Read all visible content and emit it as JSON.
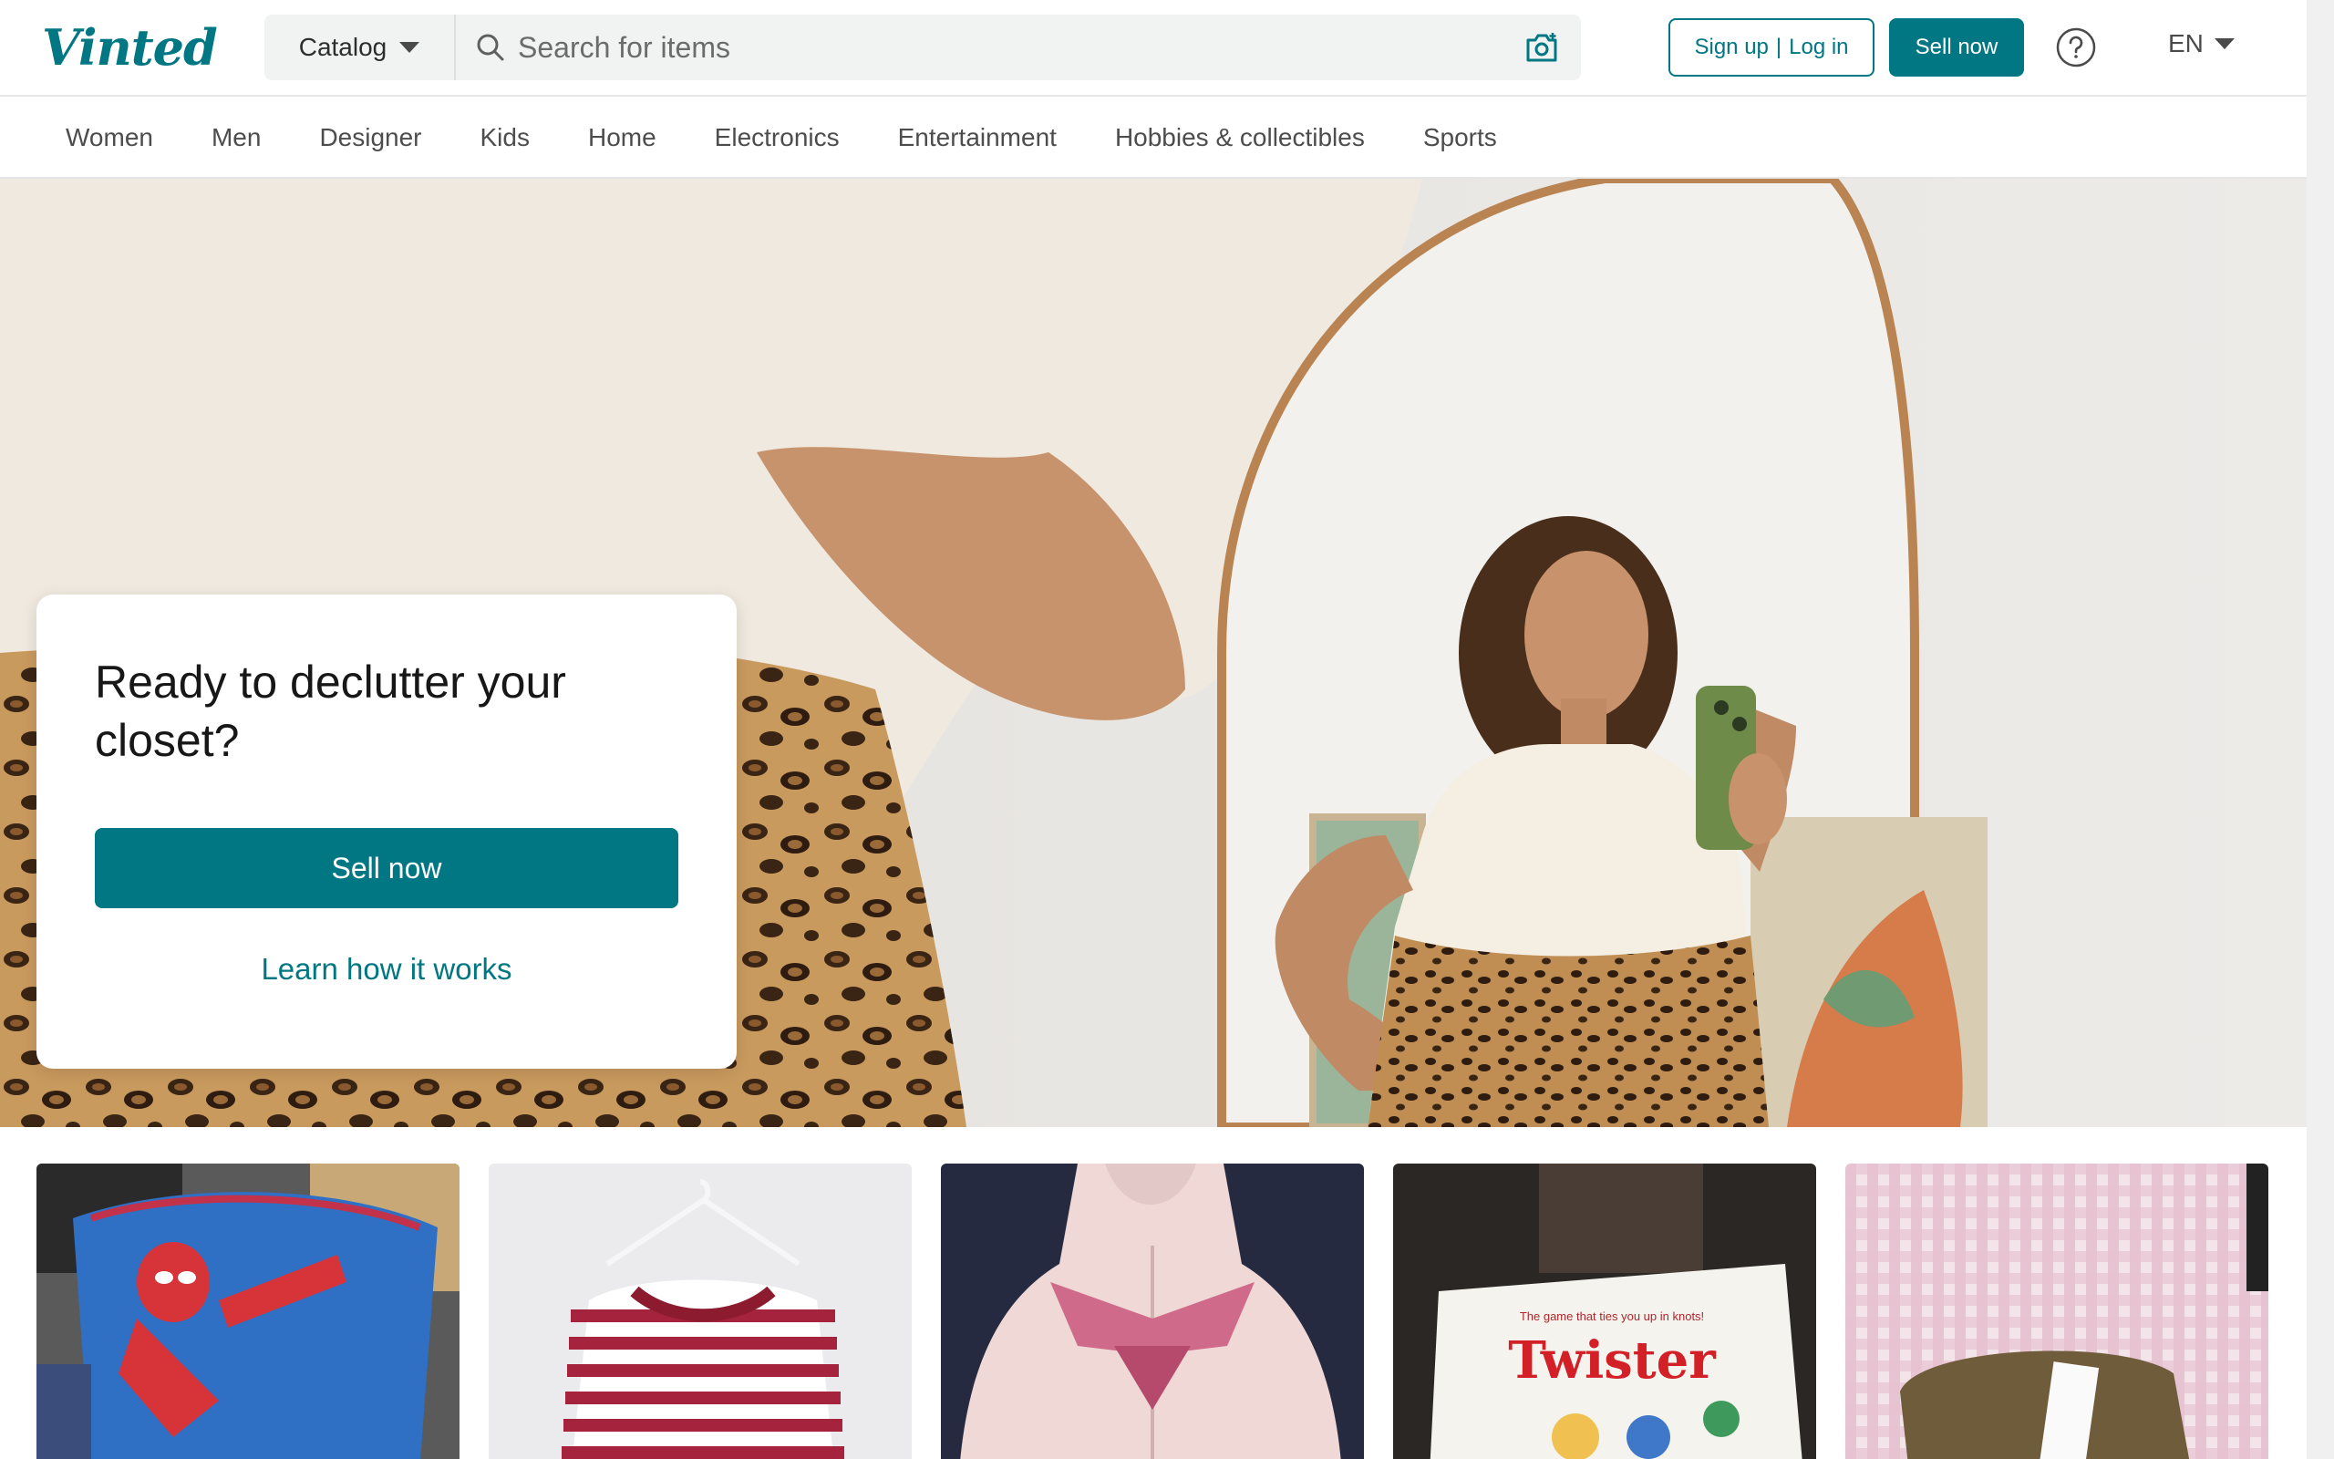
{
  "header": {
    "logo": "Vinted",
    "catalog_label": "Catalog",
    "search_placeholder": "Search for items",
    "signup_label": "Sign up",
    "login_label": "Log in",
    "sell_now_label": "Sell now",
    "language": "EN"
  },
  "categories": [
    "Women",
    "Men",
    "Designer",
    "Kids",
    "Home",
    "Electronics",
    "Entertainment",
    "Hobbies & collectibles",
    "Sports"
  ],
  "hero": {
    "title": "Ready to declutter your closet?",
    "sell_now_label": "Sell now",
    "learn_label": "Learn how it works"
  },
  "items": {
    "twister_text": "Twister",
    "twister_tagline": "The game that ties you up in knots!"
  },
  "colors": {
    "brand": "#007782"
  }
}
